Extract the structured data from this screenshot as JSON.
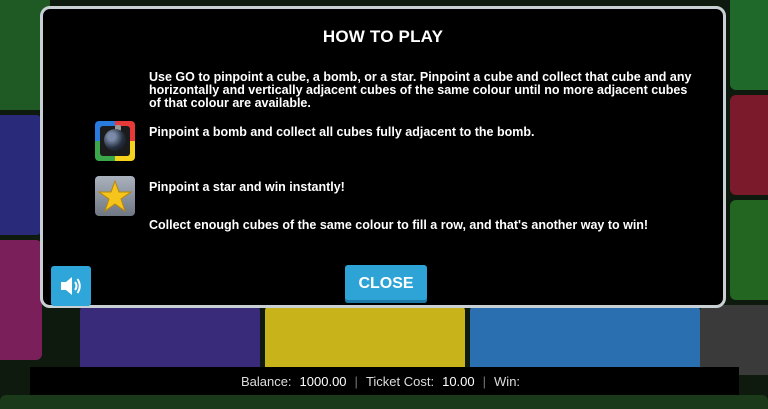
{
  "dialog": {
    "title": "HOW TO PLAY",
    "rules": [
      "Use GO to pinpoint a cube, a bomb, or a star. Pinpoint a cube and collect that cube and any horizontally and vertically adjacent cubes of the same colour until no more adjacent cubes of that colour are available.",
      "Pinpoint a bomb and collect all cubes fully adjacent to the bomb.",
      "Pinpoint a star and win instantly!",
      "Collect enough cubes of the same colour to fill a row, and that's another way to win!"
    ],
    "icons": [
      "bomb-icon",
      "star-icon",
      "speaker-icon"
    ],
    "close_label": "CLOSE"
  },
  "status": {
    "balance_label": "Balance:",
    "balance_value": "1000.00",
    "ticket_label": "Ticket Cost:",
    "ticket_value": "10.00",
    "win_label": "Win:",
    "win_value": ""
  },
  "colors": {
    "accent": "#2ea3d6",
    "modal_bg": "#000000",
    "modal_border": "#c9d0d4"
  }
}
